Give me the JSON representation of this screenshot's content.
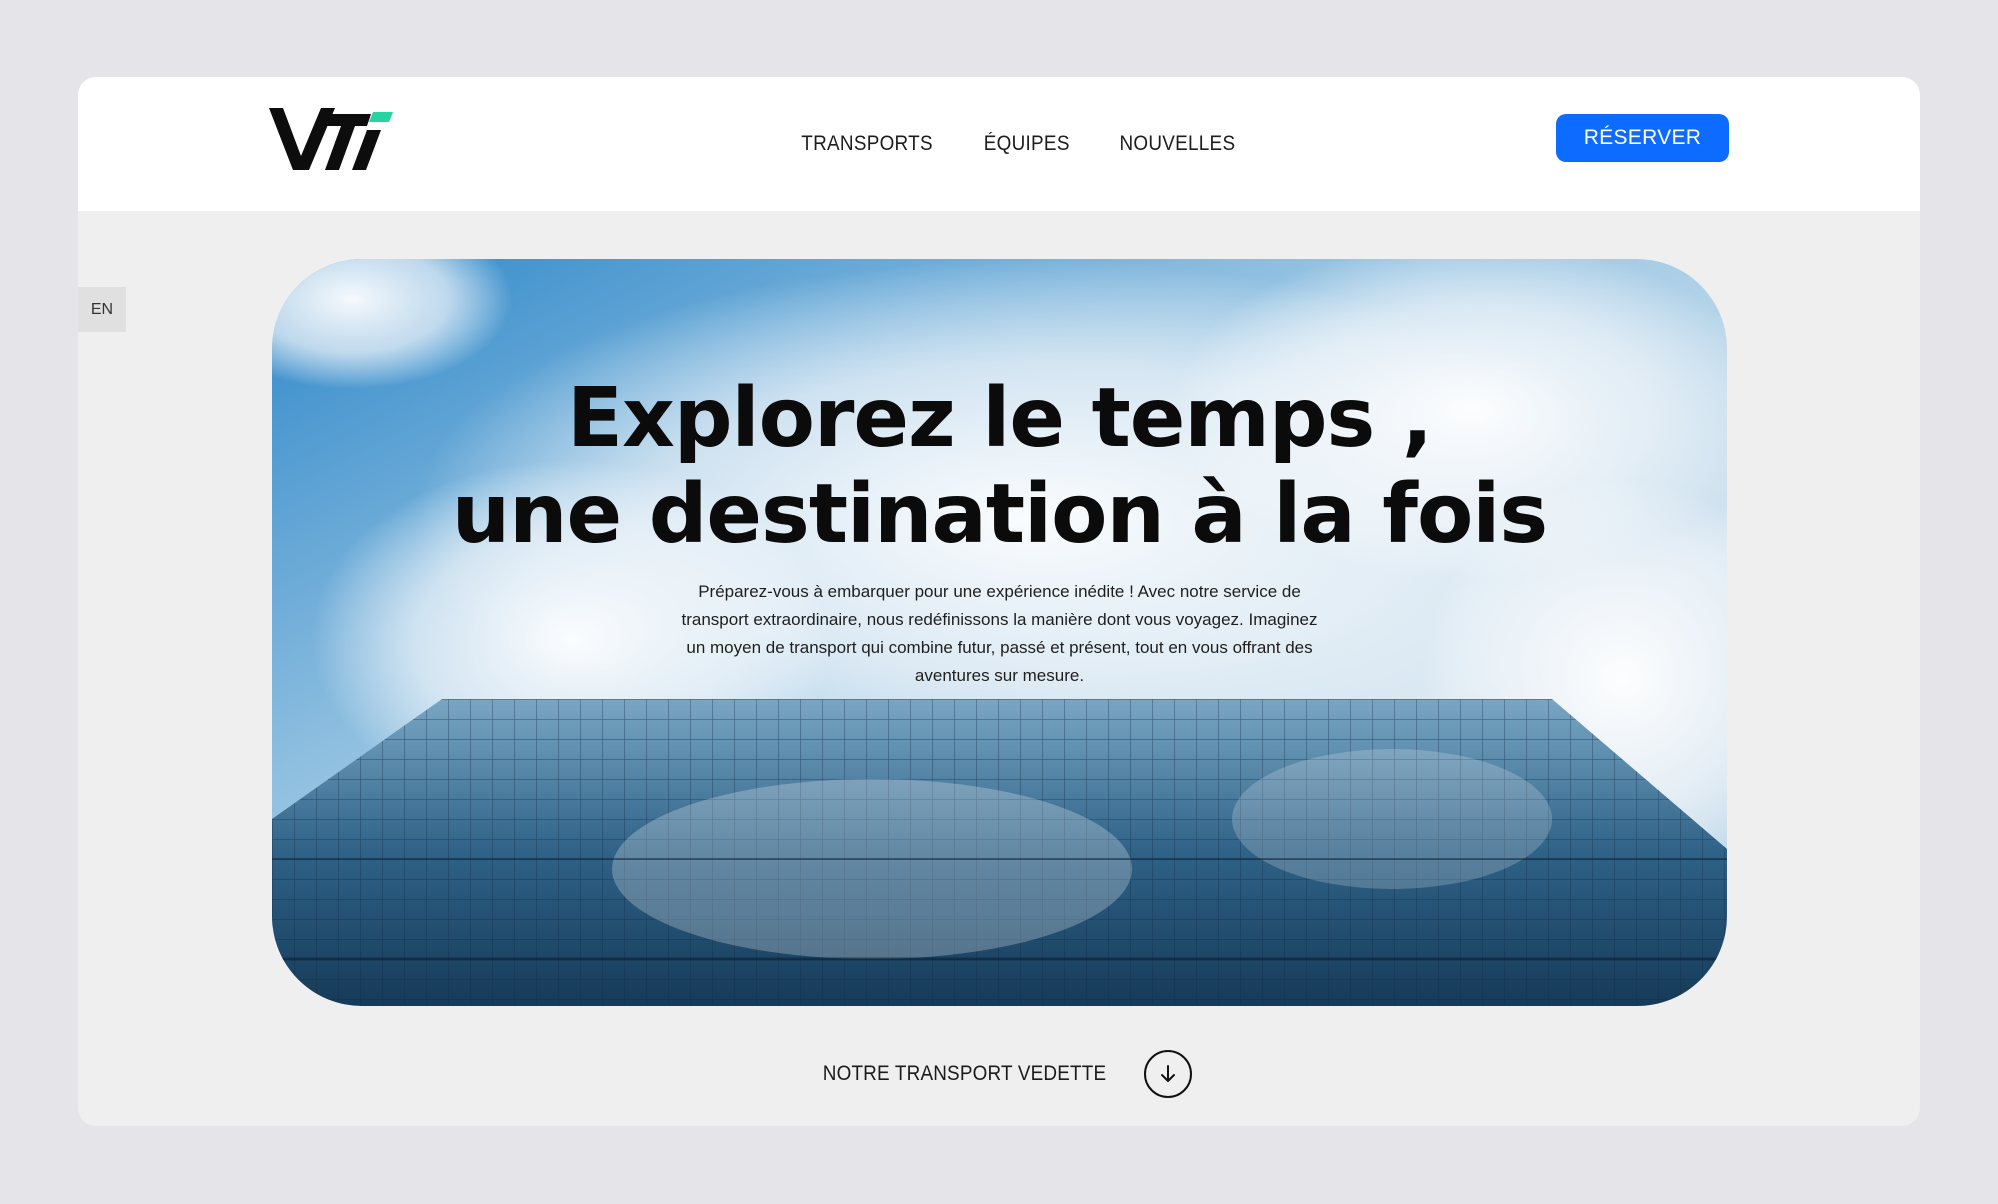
{
  "brand": {
    "logo_text": "VTi",
    "accent_color": "#27d3a0"
  },
  "nav": {
    "items": [
      "TRANSPORTS",
      "ÉQUIPES",
      "NOUVELLES"
    ]
  },
  "header": {
    "cta_label": "RÉSERVER",
    "cta_color": "#0e6bff"
  },
  "language": {
    "label": "EN"
  },
  "hero": {
    "title_line1": "Explorez le temps ,",
    "title_line2": "une destination à la fois",
    "subtitle": "Préparez-vous à embarquer pour une expérience inédite ! Avec notre service de transport extraordinaire, nous redéfinissons la manière dont vous voyagez. Imaginez un moyen de transport qui combine futur, passé et présent, tout en vous offrant des aventures sur mesure."
  },
  "featured": {
    "label": "NOTRE TRANSPORT VEDETTE",
    "icon": "arrow-down-icon"
  }
}
